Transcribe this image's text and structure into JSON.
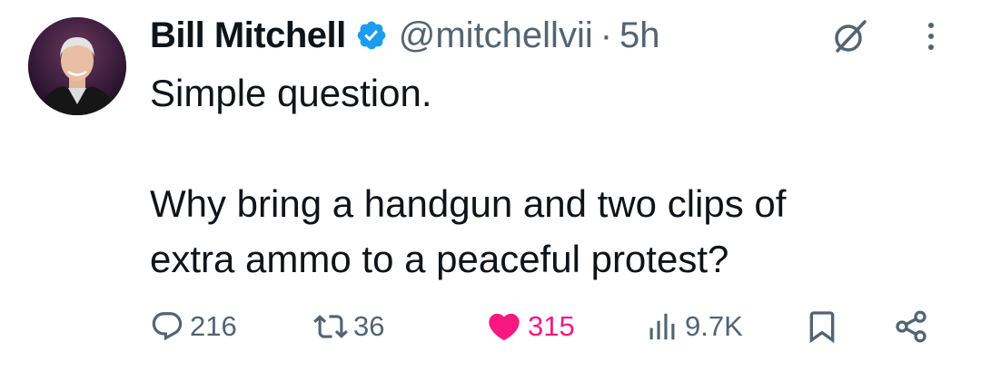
{
  "tweet": {
    "author_name": "Bill Mitchell",
    "handle": "@mitchellvii",
    "separator": "·",
    "time": "5h",
    "verified": true,
    "text_lines": [
      "Simple question.",
      "Why bring a handgun and two clips of",
      "extra ammo to a peaceful protest?"
    ],
    "icons": {
      "verified": "verified-badge-icon",
      "grok": "grok-icon",
      "more": "more-options-icon"
    }
  },
  "actions": {
    "reply": {
      "icon": "reply-icon",
      "count": "216"
    },
    "retweet": {
      "icon": "retweet-icon",
      "count": "36"
    },
    "like": {
      "icon": "heart-icon",
      "count": "315",
      "liked": true
    },
    "views": {
      "icon": "views-icon",
      "count": "9.7K"
    },
    "bookmark": {
      "icon": "bookmark-icon"
    },
    "share": {
      "icon": "share-icon"
    }
  },
  "colors": {
    "text": "#0f1419",
    "secondary": "#536471",
    "verified": "#1d9bf0",
    "like": "#f91880"
  }
}
